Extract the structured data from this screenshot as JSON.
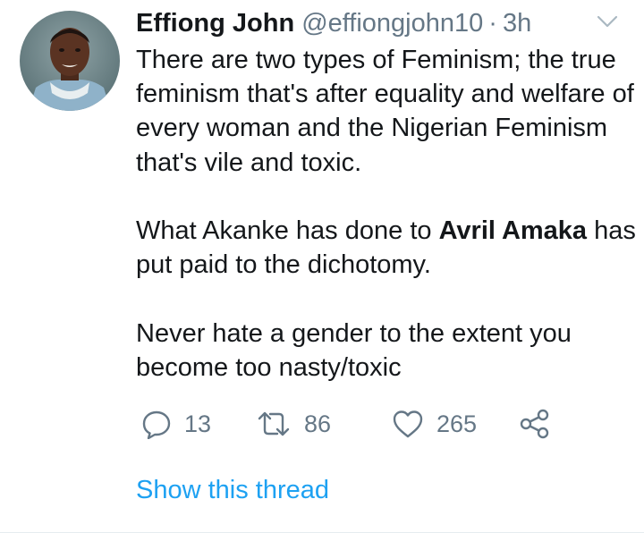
{
  "tweet": {
    "author": {
      "name": "Effiong John",
      "handle": "@effiongjohn10",
      "separator": "·",
      "time": "3h",
      "avatar_icon": "avatar-photo"
    },
    "body": {
      "p1": "There are two types of Feminism; the true feminism that's after equality and welfare of every woman and the Nigerian Feminism that's vile and toxic.",
      "p2_before": "What Akanke has done to ",
      "p2_mention": "Avril Amaka",
      "p2_after": " has put paid to the dichotomy.",
      "p3": "Never hate a gender to the extent you become too nasty/toxic"
    },
    "actions": {
      "reply_count": "13",
      "retweet_count": "86",
      "like_count": "265",
      "reply_icon": "reply-icon",
      "retweet_icon": "retweet-icon",
      "like_icon": "heart-icon",
      "share_icon": "share-icon"
    },
    "show_thread": "Show this thread",
    "menu_icon": "chevron-down-icon"
  },
  "colors": {
    "text": "#14171a",
    "muted": "#657786",
    "link": "#1da1f2"
  }
}
